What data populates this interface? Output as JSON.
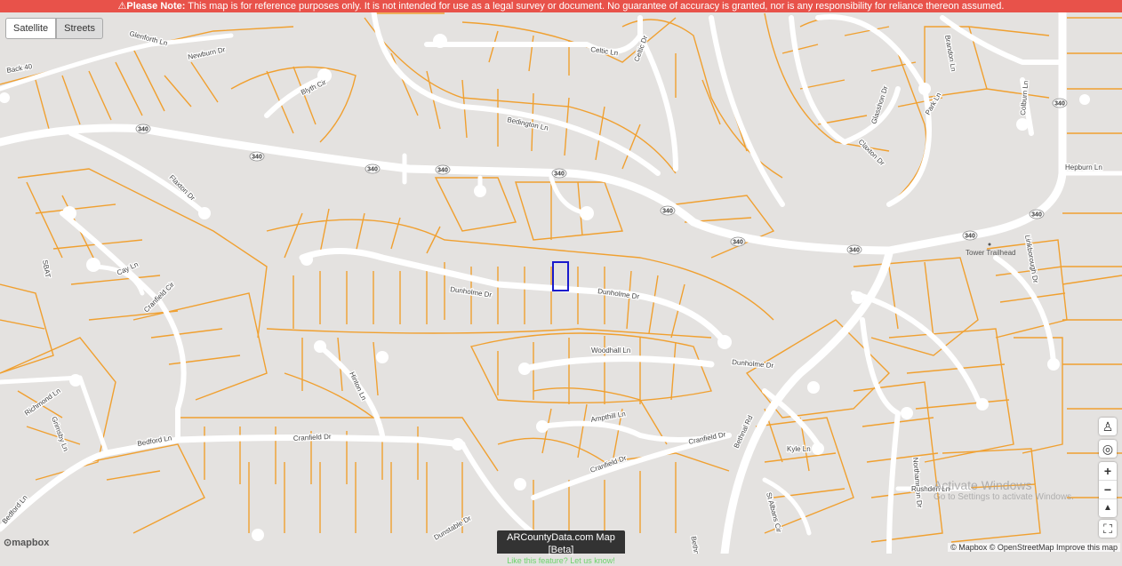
{
  "banner": {
    "prefix": "Please Note:",
    "text": "This map is for reference purposes only. It is not intended for use as a legal survey or document. No guarantee of accuracy is granted, nor is any responsibility for reliance thereon assumed."
  },
  "layers": {
    "satellite": "Satellite",
    "streets": "Streets"
  },
  "highway_shield": "340",
  "roads": [
    "Glenforth Ln",
    "Newburn Dr",
    "Back 40",
    "Blyth Cir",
    "Bedington Ln",
    "Celtic Ln",
    "Celtic Dr",
    "Glasshon Dr",
    "Claxton Dr",
    "Park Ln",
    "Brandon Ln",
    "Colburn Ln",
    "Hepburn Ln",
    "Flaxton Dr",
    "Dunholme Dr",
    "Woodhall Ln",
    "Cay Ln",
    "Cranfield Cir",
    "Richmond Ln",
    "Grimsby Ln",
    "Hinton Ln",
    "Bedford Ln",
    "Cranfield Dr",
    "Ampthill Ln",
    "Bethnal Rd",
    "Kyle Ln",
    "Northampton Dr",
    "Rushden Ln",
    "St Albans Cir",
    "Dunstable Dr",
    "Bedford Ln",
    "Linkborough Dr",
    "SBAT"
  ],
  "poi": "Tower Trailhead",
  "controls": {
    "pegman": "pegman-icon",
    "locate": "◎",
    "zoom_in": "+",
    "zoom_out": "−",
    "compass": "▲",
    "fullscreen": "⛶"
  },
  "branding": {
    "title": "ARCountyData.com Map [Beta]",
    "link": "Like this feature? Let us know!"
  },
  "mapbox_logo": "mapbox",
  "attribution": "© Mapbox © OpenStreetMap Improve this map",
  "watermark": {
    "line1": "Activate Windows",
    "line2": "Go to Settings to activate Windows."
  },
  "colors": {
    "parcel": "#f0a030",
    "road": "#ffffff",
    "background": "#e4e2e0",
    "selected": "#1a1acc",
    "banner": "#e8524a"
  }
}
